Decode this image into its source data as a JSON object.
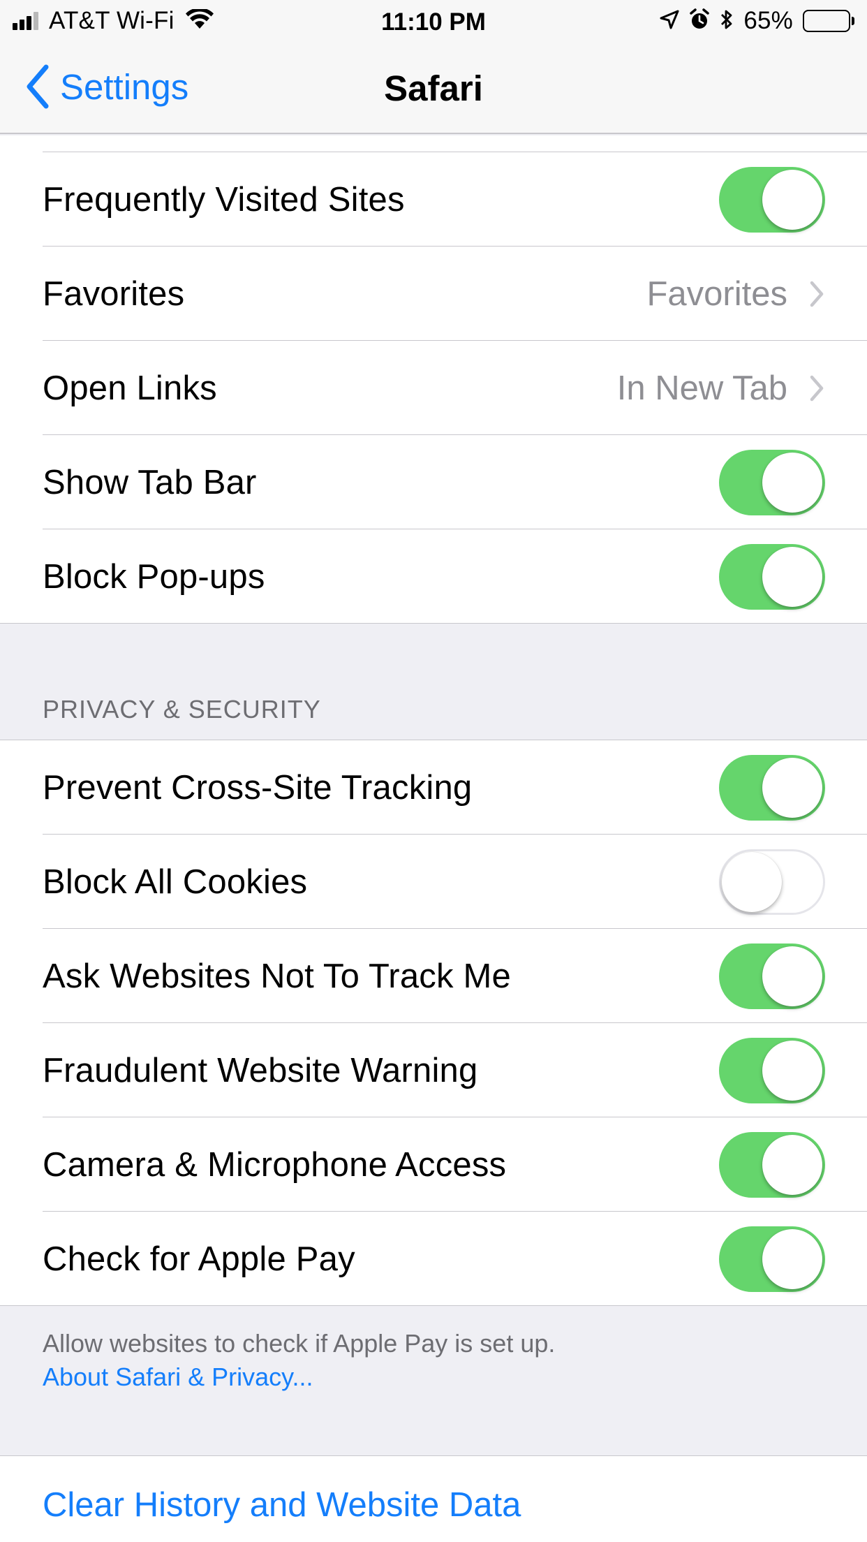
{
  "status_bar": {
    "carrier": "AT&T Wi-Fi",
    "time": "11:10 PM",
    "battery_percent": "65%",
    "battery_level": 0.65,
    "signal_bars": 3,
    "icons": [
      "signal-icon",
      "wifi-icon",
      "location-icon",
      "alarm-icon",
      "bluetooth-icon",
      "battery-icon"
    ]
  },
  "nav_bar": {
    "back_label": "Settings",
    "title": "Safari"
  },
  "general_group": {
    "rows": [
      {
        "label": "Frequently Visited Sites",
        "type": "toggle",
        "on": true
      },
      {
        "label": "Favorites",
        "type": "disclosure",
        "value": "Favorites"
      },
      {
        "label": "Open Links",
        "type": "disclosure",
        "value": "In New Tab"
      },
      {
        "label": "Show Tab Bar",
        "type": "toggle",
        "on": true
      },
      {
        "label": "Block Pop-ups",
        "type": "toggle",
        "on": true
      }
    ]
  },
  "privacy_section": {
    "header": "PRIVACY & SECURITY",
    "rows": [
      {
        "label": "Prevent Cross-Site Tracking",
        "type": "toggle",
        "on": true
      },
      {
        "label": "Block All Cookies",
        "type": "toggle",
        "on": false
      },
      {
        "label": "Ask Websites Not To Track Me",
        "type": "toggle",
        "on": true
      },
      {
        "label": "Fraudulent Website Warning",
        "type": "toggle",
        "on": true
      },
      {
        "label": "Camera & Microphone Access",
        "type": "toggle",
        "on": true
      },
      {
        "label": "Check for Apple Pay",
        "type": "toggle",
        "on": true
      }
    ],
    "footer_text": "Allow websites to check if Apple Pay is set up.",
    "footer_link": "About Safari & Privacy..."
  },
  "clear_history": {
    "label": "Clear History and Website Data"
  },
  "colors": {
    "accent": "#147efb",
    "toggle_on": "#65d56c",
    "secondary_text": "#8e8e93",
    "group_background": "#efeff4"
  }
}
